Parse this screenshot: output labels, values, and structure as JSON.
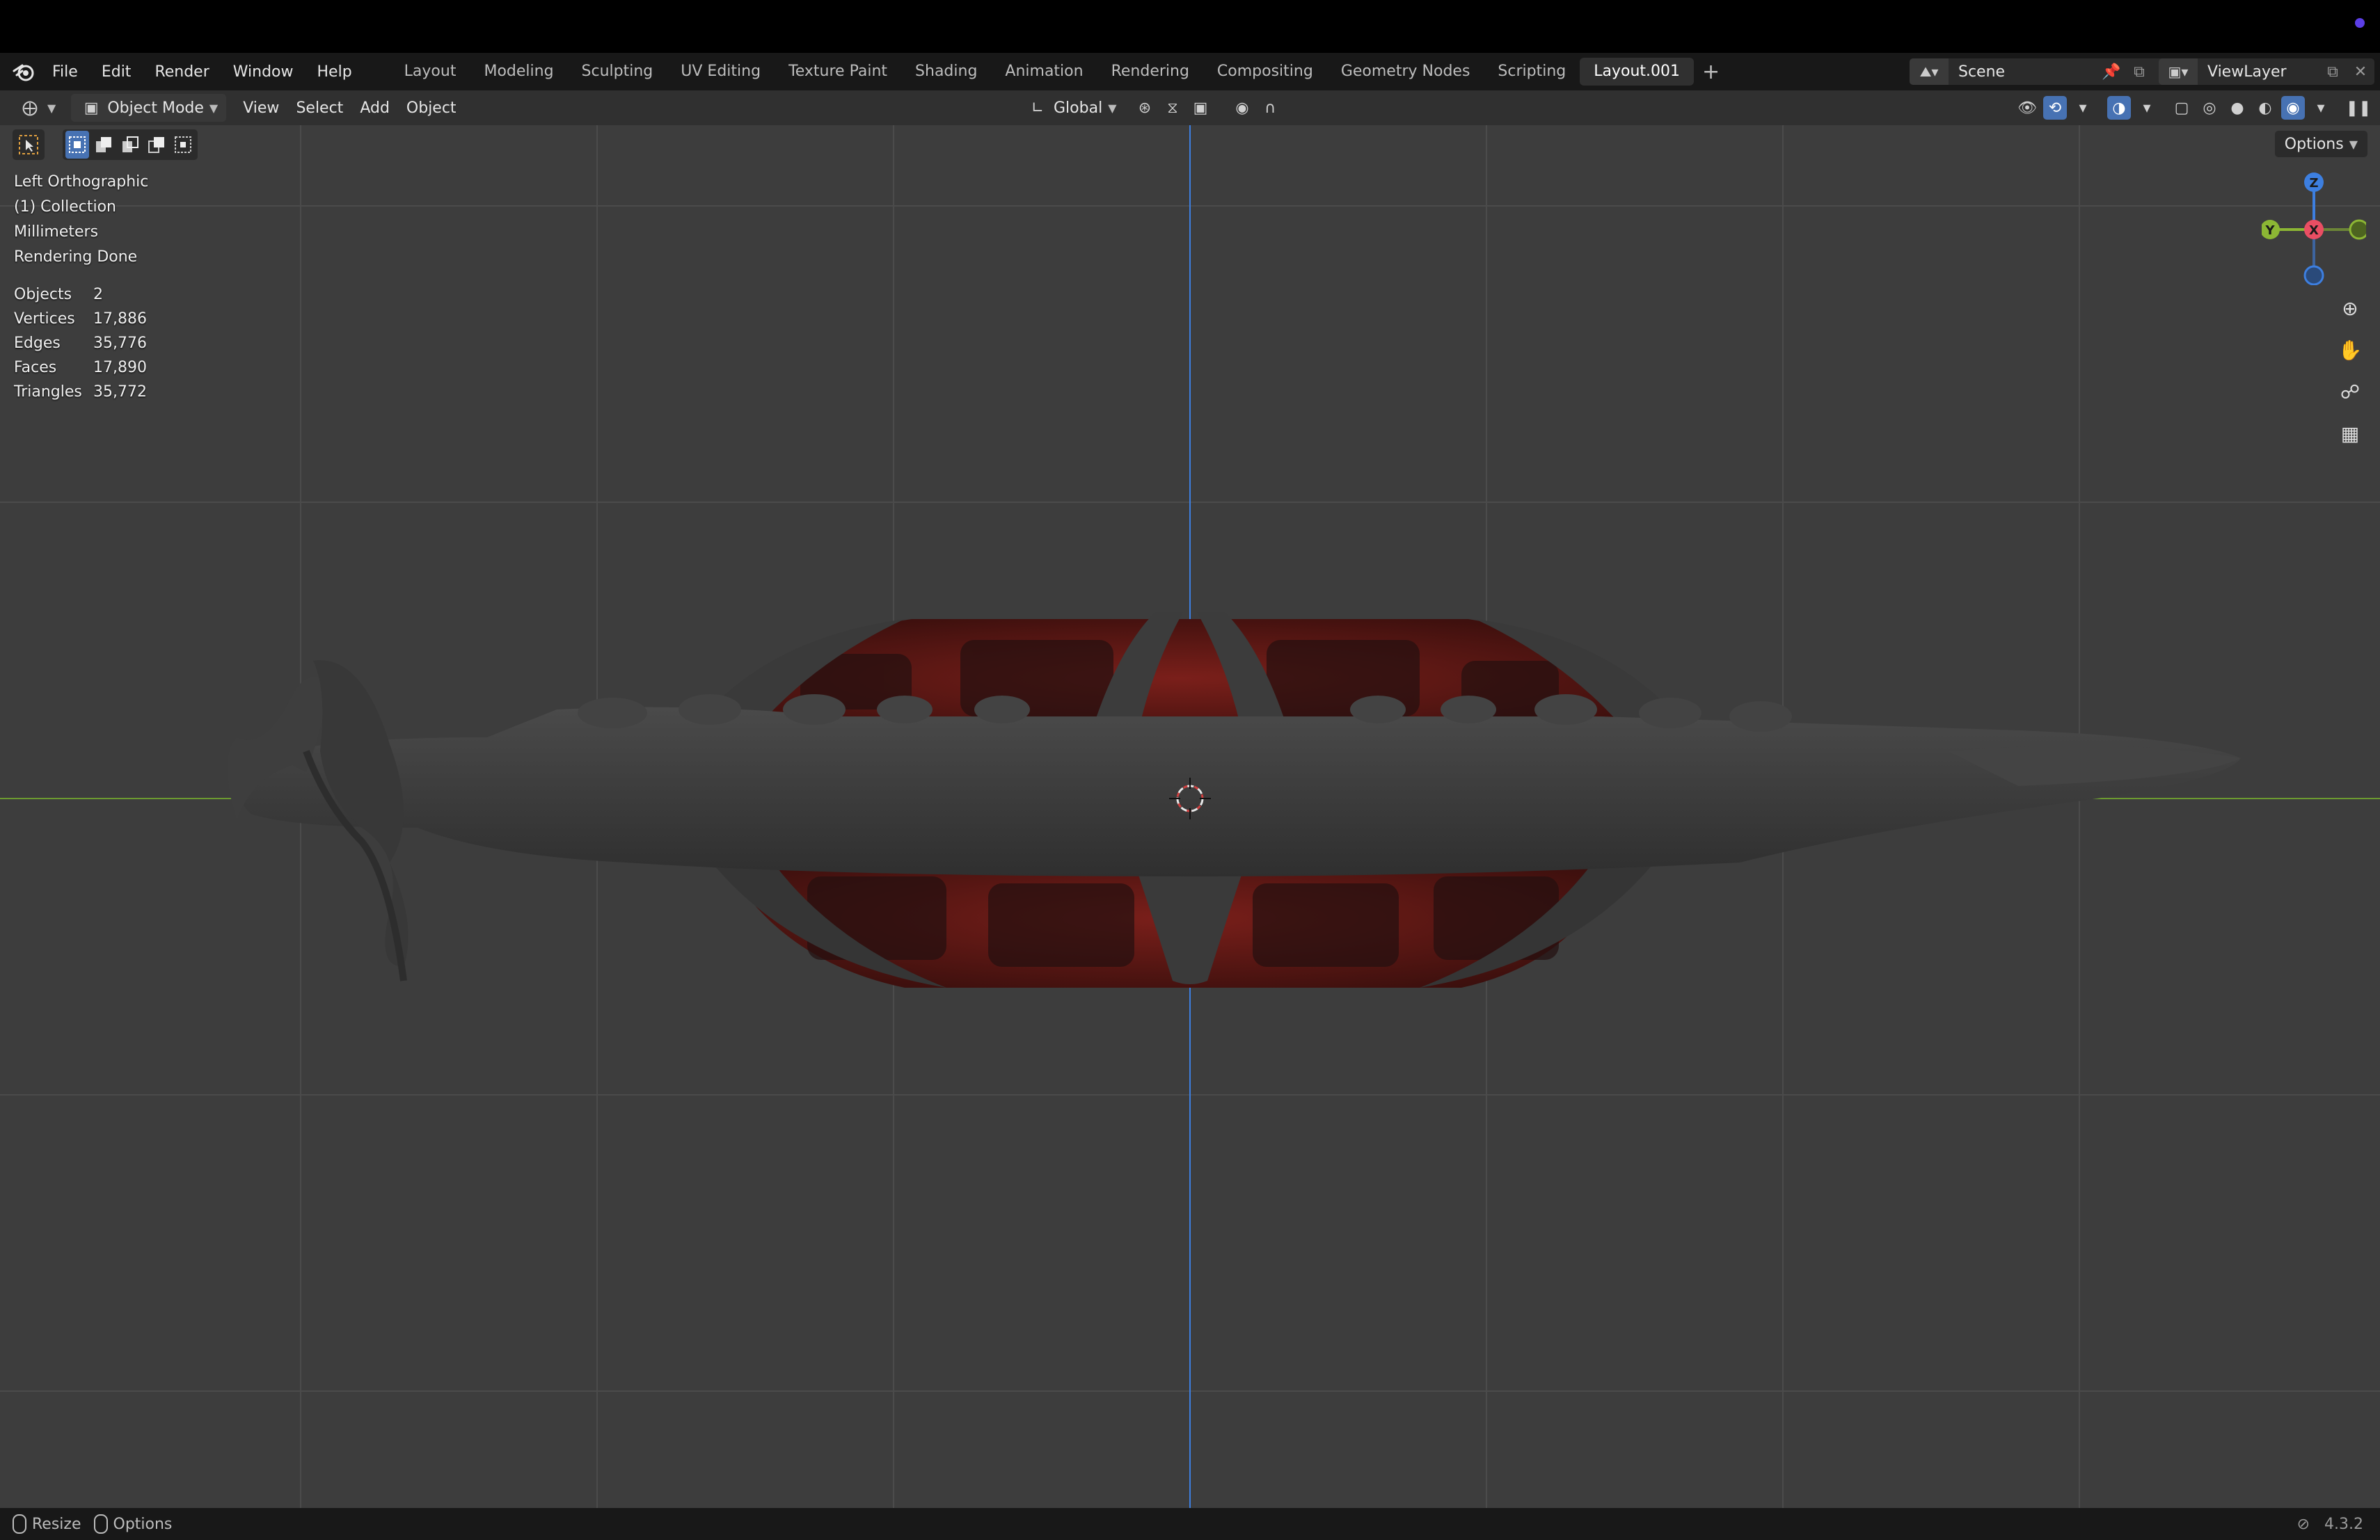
{
  "menu": {
    "items": [
      "File",
      "Edit",
      "Render",
      "Window",
      "Help"
    ]
  },
  "workspaces": {
    "tabs": [
      "Layout",
      "Modeling",
      "Sculpting",
      "UV Editing",
      "Texture Paint",
      "Shading",
      "Animation",
      "Rendering",
      "Compositing",
      "Geometry Nodes",
      "Scripting",
      "Layout.001"
    ],
    "active": "Layout.001",
    "add_label": "+"
  },
  "scene": {
    "name": "Scene"
  },
  "view_layer": {
    "name": "ViewLayer"
  },
  "viewport_header": {
    "mode": "Object Mode",
    "menus": [
      "View",
      "Select",
      "Add",
      "Object"
    ],
    "transform_orientation": "Global"
  },
  "viewport": {
    "options_label": "Options",
    "view_name": "Left Orthographic",
    "collection": "(1) Collection",
    "units": "Millimeters",
    "render_status": "Rendering Done",
    "stats": [
      {
        "label": "Objects",
        "value": "2"
      },
      {
        "label": "Vertices",
        "value": "17,886"
      },
      {
        "label": "Edges",
        "value": "35,776"
      },
      {
        "label": "Faces",
        "value": "17,890"
      },
      {
        "label": "Triangles",
        "value": "35,772"
      }
    ],
    "gizmo": {
      "z": "Z",
      "y": "Y",
      "x": "X"
    }
  },
  "statusbar": {
    "resize_label": "Resize",
    "options_label": "Options",
    "version": "4.3.2"
  },
  "colors": {
    "accent": "#4772b3",
    "axis_x": "#e94e63",
    "axis_y": "#8cb634",
    "axis_z": "#3d7fe0",
    "viewport_bg": "#3d3d3d"
  }
}
